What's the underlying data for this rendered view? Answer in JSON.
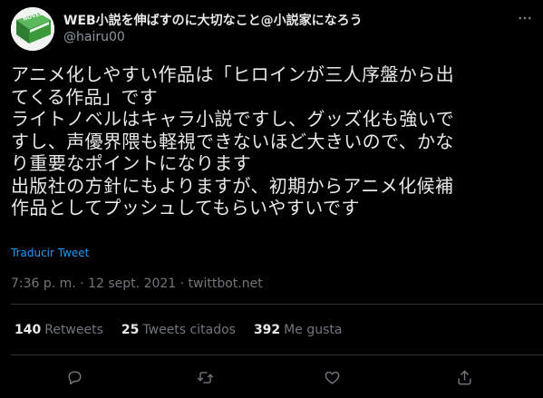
{
  "account": {
    "display_name": "WEB小説を伸ばすのに大切なこと@小説家になろう",
    "handle": "@hairu00",
    "avatar_text": "NOVEL"
  },
  "tweet": {
    "text": "アニメ化しやすい作品は「ヒロインが三人序盤から出\nてくる作品」です\nライトノベルはキャラ小説ですし、グッズ化も強いで\nすし、声優界隈も軽視できないほど大きいので、かな\nり重要なポイントになります\n出版社の方針にもよりますが、初期からアニメ化候補\n作品としてプッシュしてもらいやすいです",
    "translate_label": "Traducir Tweet",
    "meta": "7:36 p. m. · 12 sept. 2021 · twittbot.net"
  },
  "stats": [
    {
      "count": "140",
      "label": "Retweets"
    },
    {
      "count": "25",
      "label": "Tweets citados"
    },
    {
      "count": "392",
      "label": "Me gusta"
    }
  ],
  "icons": {
    "more": "more-icon",
    "reply": "reply-icon",
    "retweet": "retweet-icon",
    "like": "heart-icon",
    "share": "share-icon"
  },
  "colors": {
    "background": "#000000",
    "text": "#e7e9ea",
    "secondary": "#71767b",
    "link": "#1d9bf0",
    "divider": "#2f3336",
    "avatar_book": "#3a9a3a"
  }
}
